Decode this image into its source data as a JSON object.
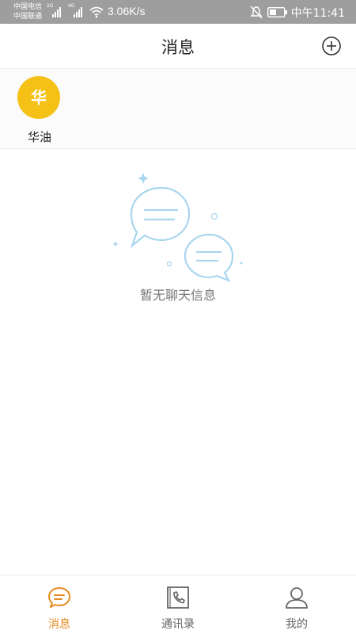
{
  "status_bar": {
    "carrier_1": "中国电信",
    "carrier_2": "中国联通",
    "net_1": "2G",
    "net_2": "4G",
    "net_speed": "3.06K/s",
    "time": "中午11:41"
  },
  "header": {
    "title": "消息",
    "add_icon": "plus-circle-icon"
  },
  "groups": [
    {
      "avatar_text": "华",
      "name": "华油"
    }
  ],
  "empty_state": {
    "message": "暂无聊天信息",
    "illustration": "chat-bubbles-icon"
  },
  "bottom_nav": {
    "items": [
      {
        "label": "消息",
        "icon": "chat-icon",
        "active": true
      },
      {
        "label": "通讯录",
        "icon": "contacts-icon",
        "active": false
      },
      {
        "label": "我的",
        "icon": "user-icon",
        "active": false
      }
    ]
  },
  "colors": {
    "accent": "#e58a1f",
    "avatar": "#f5c117",
    "illustration": "#a9d6ef",
    "status_bar": "#9e9e9e"
  }
}
